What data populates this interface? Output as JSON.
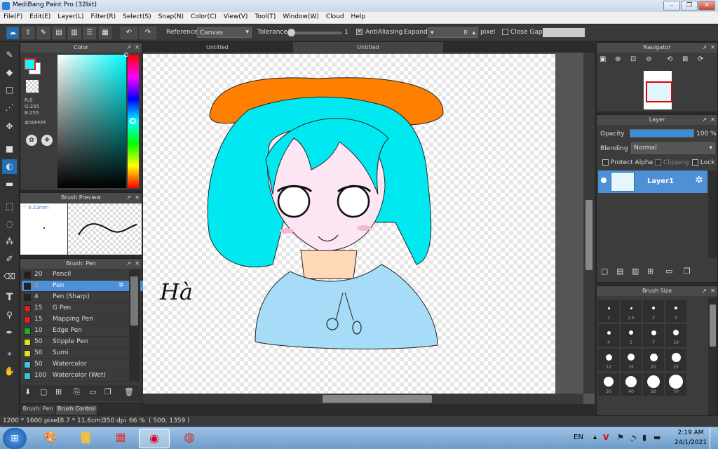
{
  "window": {
    "title": "MediBang Paint Pro (32bit)"
  },
  "menu": [
    "File(F)",
    "Edit(E)",
    "Layer(L)",
    "Filter(R)",
    "Select(S)",
    "Snap(N)",
    "Color(C)",
    "View(V)",
    "Tool(T)",
    "Window(W)",
    "Cloud",
    "Help"
  ],
  "toolbar": {
    "reference_label": "Reference",
    "reference_value": "Canvas",
    "tolerance_label": "Tolerance",
    "tolerance_value": "1",
    "antialiasing_label": "AntiAliasing",
    "expand_label": "Expand",
    "expand_value": "0",
    "expand_unit": "pixel",
    "close_gaps_label": "Close Gaps"
  },
  "color_panel": {
    "title": "Color",
    "r": "R:0",
    "g": "G:255",
    "b": "B:255",
    "hex": "#00FFFF",
    "foreground": "#00FFFF",
    "background": "#FFFFFF"
  },
  "brush_preview": {
    "title": "Brush Preview",
    "size": "0.22mm"
  },
  "brush_panel": {
    "title": "Brush: Pen",
    "items": [
      {
        "size": "20",
        "name": "Pencil",
        "color": "#222222"
      },
      {
        "size": "3",
        "name": "Pen",
        "color": "#222222",
        "selected": true
      },
      {
        "size": "4",
        "name": "Pen (Sharp)",
        "color": "#222222"
      },
      {
        "size": "15",
        "name": "G Pen",
        "color": "#e02020"
      },
      {
        "size": "15",
        "name": "Mapping Pen",
        "color": "#e02020"
      },
      {
        "size": "10",
        "name": "Edge Pen",
        "color": "#20b020"
      },
      {
        "size": "50",
        "name": "Stipple Pen",
        "color": "#e0e020"
      },
      {
        "size": "50",
        "name": "Sumi",
        "color": "#e0e020"
      },
      {
        "size": "50",
        "name": "Watercolor",
        "color": "#40c0e0"
      },
      {
        "size": "100",
        "name": "Watercolor (Wet)",
        "color": "#40c0e0"
      }
    ],
    "tab_brush": "Brush: Pen",
    "tab_control": "Brush Control"
  },
  "canvas": {
    "tabs": [
      "Untitled",
      "Untitled"
    ],
    "handwriting": "Hà"
  },
  "navigator": {
    "title": "Navigator"
  },
  "layer_panel": {
    "title": "Layer",
    "opacity_label": "Opacity",
    "opacity_value": "100 %",
    "opacity_fraction": 1.0,
    "blending_label": "Blending",
    "blending_value": "Normal",
    "protect_alpha": "Protect Alpha",
    "clipping": "Clipping",
    "lock": "Lock",
    "layer_name": "Layer1"
  },
  "brush_size_panel": {
    "title": "Brush Size",
    "sizes": [
      "1",
      "1.5",
      "2",
      "3",
      "4",
      "5",
      "7",
      "10",
      "12",
      "15",
      "20",
      "25",
      "30",
      "40",
      "50",
      "70"
    ]
  },
  "status": {
    "dimensions": "1200 * 1600 pixel",
    "physical": "(8.7 * 11.6cm)",
    "dpi": "350 dpi",
    "zoom": "66 %",
    "coords": "( 500, 1359 )"
  },
  "taskbar": {
    "lang": "EN",
    "time": "2:19 AM",
    "date": "24/1/2021"
  }
}
